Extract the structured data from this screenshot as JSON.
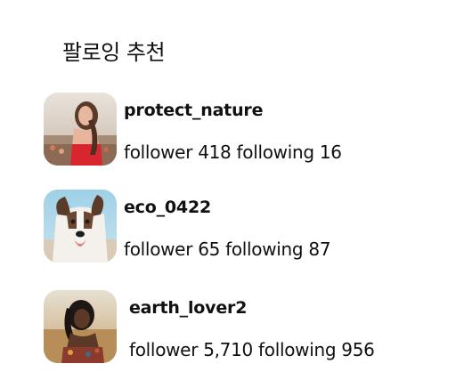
{
  "section": {
    "title": "팔로잉 추천"
  },
  "users": [
    {
      "username": "protect_nature",
      "follower_label": "follower",
      "follower_count": "418",
      "following_label": "following",
      "following_count": "16",
      "avatar": "woman-portrait-photo"
    },
    {
      "username": "eco_0422",
      "follower_label": "follower",
      "follower_count": "65",
      "following_label": "following",
      "following_count": "87",
      "avatar": "dog-photo"
    },
    {
      "username": "earth_lover2",
      "follower_label": "follower",
      "follower_count": "5,710",
      "following_label": "following",
      "following_count": "956",
      "avatar": "woman-field-photo"
    }
  ]
}
